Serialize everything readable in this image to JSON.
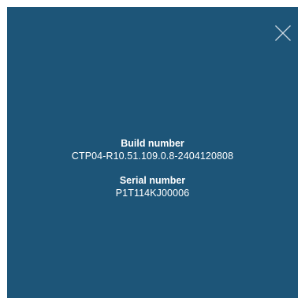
{
  "dialog": {
    "close_icon": "close-icon",
    "background_color": "#1d5578",
    "build": {
      "label": "Build number",
      "value": "CTP04-R10.51.109.0.8-2404120808"
    },
    "serial": {
      "label": "Serial number",
      "value": "P1T114KJ00006"
    }
  }
}
